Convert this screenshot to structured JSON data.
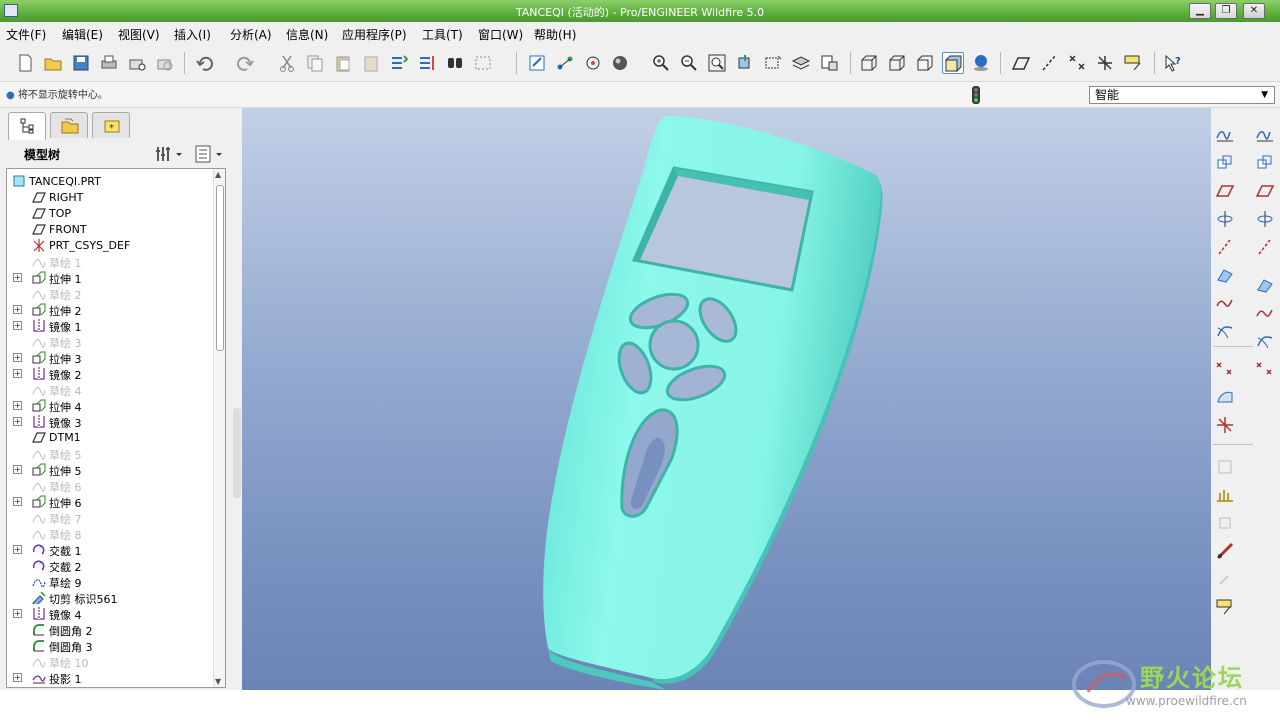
{
  "window": {
    "title": "TANCEQI (活动的) - Pro/ENGINEER Wildfire 5.0",
    "controls": [
      "minimize",
      "maximize",
      "close"
    ]
  },
  "menubar": {
    "items": [
      "文件(F)",
      "编辑(E)",
      "视图(V)",
      "插入(I)",
      "分析(A)",
      "信息(N)",
      "应用程序(P)",
      "工具(T)",
      "窗口(W)",
      "帮助(H)"
    ]
  },
  "toolbar": {
    "groups": [
      [
        "new-icon",
        "open-icon",
        "save-icon",
        "print-icon",
        "email-icon",
        "email-link-icon"
      ],
      [
        "undo-icon",
        "redo-icon",
        "cut-icon",
        "copy-icon",
        "paste-icon",
        "paste-special-icon",
        "regenerate-icon",
        "regen-manager-icon",
        "find-icon",
        "select-box-icon"
      ],
      [
        "repaint-icon",
        "spin-center-icon",
        "orient-mode-icon",
        "appearance-icon",
        "zoom-in-icon",
        "zoom-out-icon",
        "refit-icon",
        "reorient-icon",
        "saved-views-icon",
        "layers-icon",
        "view-manager-icon"
      ],
      [
        "wireframe-icon",
        "hidden-line-icon",
        "no-hidden-icon",
        "shading-icon",
        "enhanced-realism-icon"
      ],
      [
        "datum-plane-display-icon",
        "datum-axis-display-icon",
        "datum-point-display-icon",
        "csys-display-icon",
        "annotation-display-icon"
      ],
      [
        "context-help-icon"
      ]
    ]
  },
  "status": {
    "message": "将不显示旋转中心。",
    "filter": "智能"
  },
  "navigator": {
    "tabs": [
      "model-tree-tab-icon",
      "folder-browser-tab-icon",
      "favorites-tab-icon"
    ],
    "title": "模型树",
    "tree": [
      {
        "label": "TANCEQI.PRT",
        "icon": "part",
        "indent": 0,
        "expand": false,
        "muted": false
      },
      {
        "label": "RIGHT",
        "icon": "plane",
        "indent": 1,
        "expand": false,
        "muted": false
      },
      {
        "label": "TOP",
        "icon": "plane",
        "indent": 1,
        "expand": false,
        "muted": false
      },
      {
        "label": "FRONT",
        "icon": "plane",
        "indent": 1,
        "expand": false,
        "muted": false
      },
      {
        "label": "PRT_CSYS_DEF",
        "icon": "csys",
        "indent": 1,
        "expand": false,
        "muted": false
      },
      {
        "label": "草绘 1",
        "icon": "sketch",
        "indent": 1,
        "expand": false,
        "muted": true
      },
      {
        "label": "拉伸 1",
        "icon": "extrude",
        "indent": 1,
        "expand": true,
        "muted": false
      },
      {
        "label": "草绘 2",
        "icon": "sketch",
        "indent": 1,
        "expand": false,
        "muted": true
      },
      {
        "label": "拉伸 2",
        "icon": "extrude",
        "indent": 1,
        "expand": true,
        "muted": false
      },
      {
        "label": "镜像 1",
        "icon": "mirror",
        "indent": 1,
        "expand": true,
        "muted": false
      },
      {
        "label": "草绘 3",
        "icon": "sketch",
        "indent": 1,
        "expand": false,
        "muted": true
      },
      {
        "label": "拉伸 3",
        "icon": "extrude",
        "indent": 1,
        "expand": true,
        "muted": false
      },
      {
        "label": "镜像 2",
        "icon": "mirror",
        "indent": 1,
        "expand": true,
        "muted": false
      },
      {
        "label": "草绘 4",
        "icon": "sketch",
        "indent": 1,
        "expand": false,
        "muted": true
      },
      {
        "label": "拉伸 4",
        "icon": "extrude",
        "indent": 1,
        "expand": true,
        "muted": false
      },
      {
        "label": "镜像 3",
        "icon": "mirror",
        "indent": 1,
        "expand": true,
        "muted": false
      },
      {
        "label": "DTM1",
        "icon": "plane",
        "indent": 1,
        "expand": false,
        "muted": false
      },
      {
        "label": "草绘 5",
        "icon": "sketch",
        "indent": 1,
        "expand": false,
        "muted": true
      },
      {
        "label": "拉伸 5",
        "icon": "extrude",
        "indent": 1,
        "expand": true,
        "muted": false
      },
      {
        "label": "草绘 6",
        "icon": "sketch",
        "indent": 1,
        "expand": false,
        "muted": true
      },
      {
        "label": "拉伸 6",
        "icon": "extrude",
        "indent": 1,
        "expand": true,
        "muted": false
      },
      {
        "label": "草绘 7",
        "icon": "sketch",
        "indent": 1,
        "expand": false,
        "muted": true
      },
      {
        "label": "草绘 8",
        "icon": "sketch",
        "indent": 1,
        "expand": false,
        "muted": true
      },
      {
        "label": "交截 1",
        "icon": "intersect",
        "indent": 1,
        "expand": true,
        "muted": false
      },
      {
        "label": "交截 2",
        "icon": "intersect",
        "indent": 1,
        "expand": false,
        "muted": false
      },
      {
        "label": "草绘 9",
        "icon": "sketch-active",
        "indent": 1,
        "expand": false,
        "muted": false
      },
      {
        "label": "切剪 标识561",
        "icon": "cut",
        "indent": 1,
        "expand": false,
        "muted": false
      },
      {
        "label": "镜像 4",
        "icon": "mirror",
        "indent": 1,
        "expand": true,
        "muted": false
      },
      {
        "label": "倒圆角 2",
        "icon": "round",
        "indent": 1,
        "expand": false,
        "muted": false
      },
      {
        "label": "倒圆角 3",
        "icon": "round",
        "indent": 1,
        "expand": false,
        "muted": false
      },
      {
        "label": "草绘 10",
        "icon": "sketch",
        "indent": 1,
        "expand": false,
        "muted": true
      },
      {
        "label": "投影 1",
        "icon": "project",
        "indent": 1,
        "expand": true,
        "muted": false
      }
    ]
  },
  "rightbar": {
    "buttons": [
      "sketch-tool-icon",
      "copy-geom-icon",
      "datum-plane-icon",
      "revolve-icon",
      "datum-axis-icon",
      "sweep-icon",
      "datum-curve-icon",
      "boundary-blend-icon",
      "datum-point-icon",
      "style-icon",
      "csys-icon",
      "freestyle-icon",
      "analysis-icon",
      "shell-icon",
      "analysis-feature-icon",
      "rib-icon",
      "note-icon",
      "draft-icon",
      "group-icon",
      "pattern-icon",
      "hole-icon",
      "shell-tool-icon",
      "rib-tool-icon",
      "draft-tool-icon",
      "round-tool-icon",
      "chamfer-tool-icon"
    ]
  },
  "colors": {
    "model": "#7ff0e0",
    "title_bar": "#5cae3c",
    "viewport_top": "#c2d0e6",
    "viewport_bottom": "#6b84b6"
  },
  "watermark": {
    "cn": "野火论坛",
    "url": "www.proewildfire.cn"
  }
}
